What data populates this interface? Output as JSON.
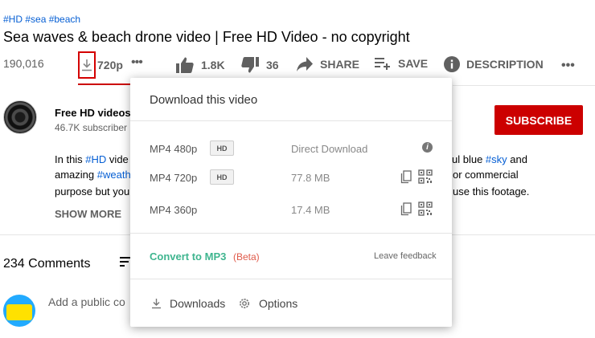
{
  "video": {
    "tags": "#HD #sea #beach",
    "title": "Sea waves & beach drone video | Free HD Video - no copyright",
    "views": "190,016",
    "quality": "720p"
  },
  "actions": {
    "likes": "1.8K",
    "dislikes": "36",
    "share": "SHARE",
    "save": "SAVE",
    "description": "DESCRIPTION"
  },
  "channel": {
    "name": "Free HD videos",
    "subscribers": "46.7K subscriber",
    "subscribe_label": "SUBSCRIBE"
  },
  "description": {
    "line1_pre": "In this ",
    "line1_tag": "#HD",
    "line1_mid": " vide",
    "line1_tail": "ul blue ",
    "line1_tag2": "#sky",
    "line1_end": " and",
    "line2_pre": "amazing ",
    "line2_tag": "#weath",
    "line2_tail": "or commercial",
    "line3_pre": "purpose but you",
    "line3_tail": "use this footage.",
    "show_more": "SHOW MORE"
  },
  "comments": {
    "count": "234 Comments",
    "add_placeholder": "Add a public co"
  },
  "popup": {
    "title": "Download this video",
    "rows": [
      {
        "format": "MP4 480p",
        "badge": "HD",
        "size": "Direct Download"
      },
      {
        "format": "MP4 720p",
        "badge": "HD",
        "size": "77.8 MB"
      },
      {
        "format": "MP4 360p",
        "badge": "",
        "size": "17.4 MB"
      }
    ],
    "convert": "Convert to MP3",
    "beta": "(Beta)",
    "feedback": "Leave feedback",
    "downloads": "Downloads",
    "options": "Options"
  },
  "colors": {
    "accent_red": "#cc0000",
    "link_blue": "#065fd4",
    "mp3_green": "#3fb58f"
  }
}
